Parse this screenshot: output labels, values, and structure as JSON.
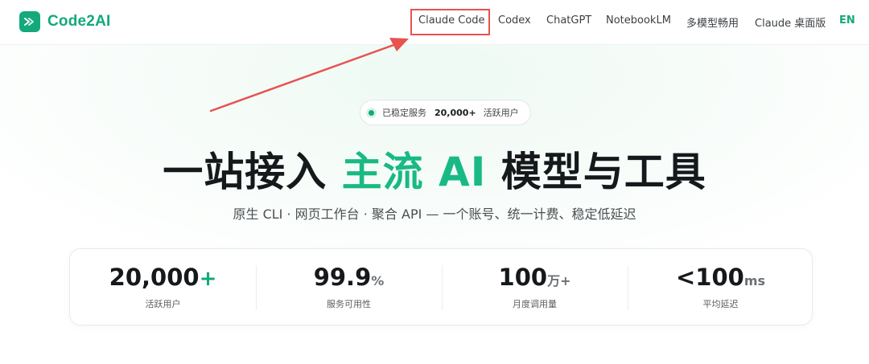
{
  "header": {
    "logo_text": "Code2AI",
    "nav": [
      {
        "label": "Claude Code"
      },
      {
        "label": "Codex"
      },
      {
        "label": "ChatGPT"
      },
      {
        "label": "NotebookLM"
      },
      {
        "label": "多模型畅用"
      },
      {
        "label": "Claude 桌面版"
      },
      {
        "label": "EN"
      }
    ]
  },
  "hero": {
    "badge": {
      "prefix": "已稳定服务",
      "count": "20,000+",
      "suffix": "活跃用户"
    },
    "title": {
      "part1": "一站接入",
      "accent": "主流 AI",
      "part2": "模型与工具"
    },
    "subtitle": "原生 CLI · 网页工作台 · 聚合 API — 一个账号、统一计费、稳定低延迟"
  },
  "stats": [
    {
      "value": "20,000",
      "suffix": "+",
      "label": "活跃用户"
    },
    {
      "value": "99.9",
      "suffix": "%",
      "label": "服务可用性"
    },
    {
      "value": "100",
      "suffix": "万+",
      "label": "月度调用量"
    },
    {
      "value": "<100",
      "suffix": "ms",
      "label": "平均延迟"
    }
  ],
  "colors": {
    "brand": "#13a97a",
    "annotation": "#e8524f"
  }
}
